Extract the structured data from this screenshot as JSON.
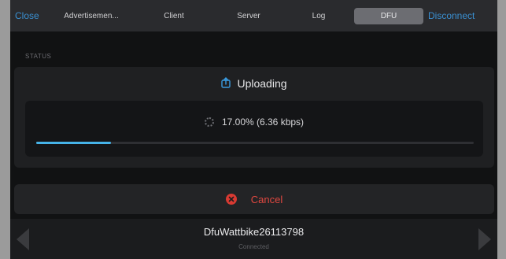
{
  "header": {
    "close_label": "Close",
    "tabs": [
      {
        "label": "Advertisemen...",
        "active": false
      },
      {
        "label": "Client",
        "active": false
      },
      {
        "label": "Server",
        "active": false
      },
      {
        "label": "Log",
        "active": false
      },
      {
        "label": "DFU",
        "active": true
      }
    ],
    "disconnect_label": "Disconnect"
  },
  "status": {
    "section_label": "STATUS",
    "state_text": "Uploading",
    "state_icon": "upload-icon",
    "progress_text": "17.00% (6.36 kbps)",
    "progress_fraction": 0.17,
    "spinner_icon": "spinner-icon"
  },
  "cancel": {
    "label": "Cancel",
    "icon": "cancel-x-icon",
    "color": "#e04840"
  },
  "device": {
    "name": "DfuWattbike26113798",
    "state": "Connected"
  },
  "colors": {
    "accent": "#3a8fd0",
    "progress": "#46b3e8",
    "danger": "#e04840"
  }
}
